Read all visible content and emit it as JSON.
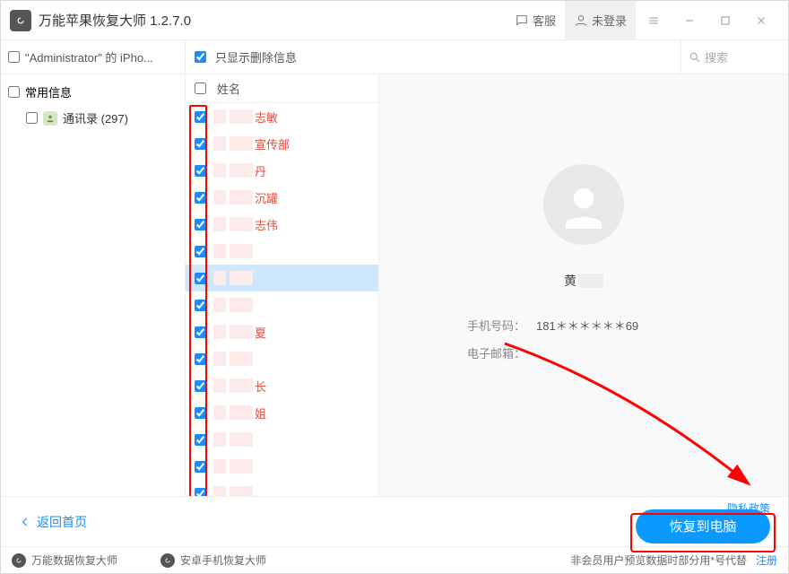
{
  "titlebar": {
    "app_name": "万能苹果恢复大师  1.2.7.0",
    "support_label": "客服",
    "login_label": "未登录"
  },
  "toolbar": {
    "device_label": "\"Administrator\" 的 iPho...",
    "filter_label": "只显示删除信息",
    "search_placeholder": "搜索"
  },
  "sidebar": {
    "group_label": "常用信息",
    "contacts_label": "通讯录 (297)"
  },
  "list": {
    "header_label": "姓名",
    "items": [
      {
        "text": "志敏",
        "checked": true,
        "selected": false
      },
      {
        "text": "宣传部",
        "checked": true,
        "selected": false
      },
      {
        "text": "丹",
        "checked": true,
        "selected": false
      },
      {
        "text": "沉罐",
        "checked": true,
        "selected": false
      },
      {
        "text": "志伟",
        "checked": true,
        "selected": false
      },
      {
        "text": "",
        "checked": true,
        "selected": false
      },
      {
        "text": "",
        "checked": true,
        "selected": true
      },
      {
        "text": "",
        "checked": true,
        "selected": false
      },
      {
        "text": "夏",
        "checked": true,
        "selected": false
      },
      {
        "text": "",
        "checked": true,
        "selected": false
      },
      {
        "text": "长",
        "checked": true,
        "selected": false
      },
      {
        "text": "姐",
        "checked": true,
        "selected": false
      },
      {
        "text": "",
        "checked": true,
        "selected": false
      },
      {
        "text": "",
        "checked": true,
        "selected": false
      },
      {
        "text": "",
        "checked": true,
        "selected": false
      }
    ]
  },
  "detail": {
    "name_prefix": "黄",
    "phone_label": "手机号码：",
    "phone_value": "181＊＊＊＊＊＊69",
    "email_label": "电子邮箱："
  },
  "bottom": {
    "back_label": "返回首页",
    "privacy_label": "隐私政策",
    "recover_label": "恢复到电脑"
  },
  "strip": {
    "prod1": "万能数据恢复大师",
    "prod2": "安卓手机恢复大师",
    "notice": "非会员用户预览数据时部分用*号代替",
    "register": "注册"
  }
}
